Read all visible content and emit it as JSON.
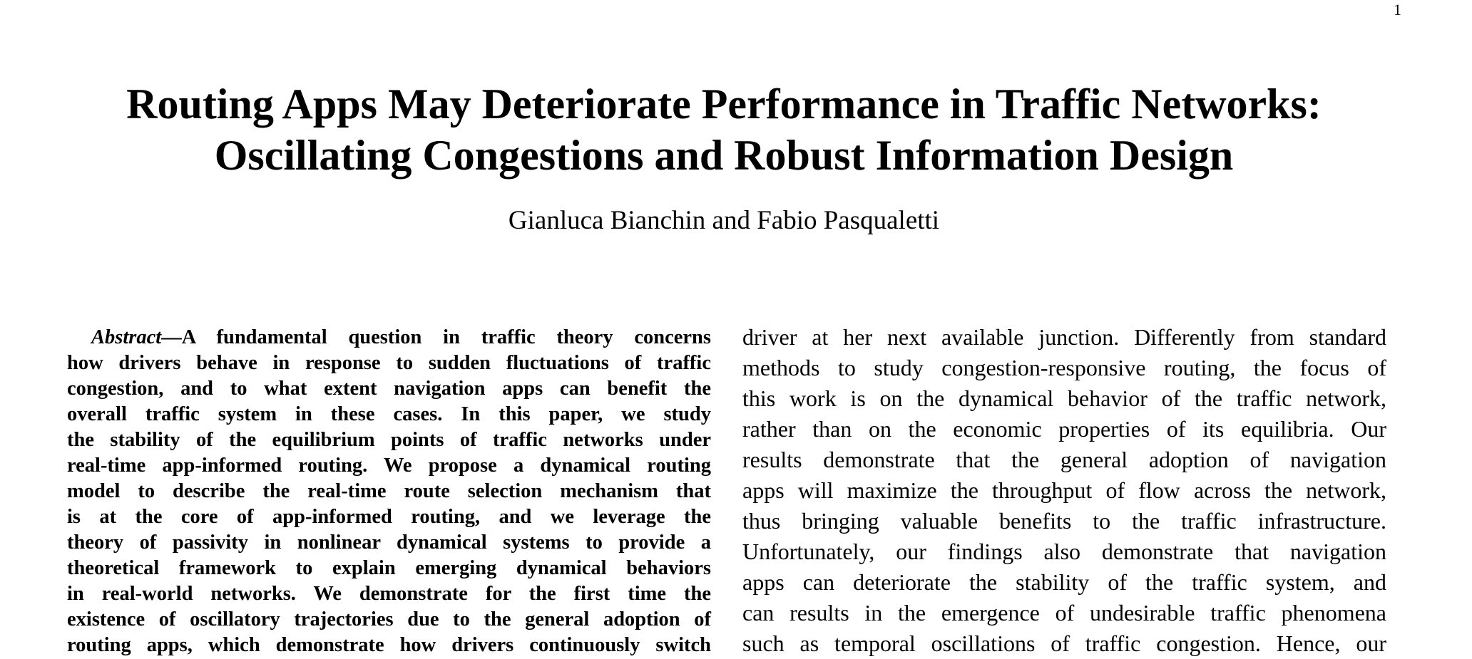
{
  "page": {
    "number": "1"
  },
  "title": {
    "lines": [
      "Routing Apps May Deteriorate Performance in Traffic Networks:",
      "Oscillating Congestions and Robust Information Design"
    ]
  },
  "authors": "Gianluca Bianchin and Fabio Pasqualetti",
  "abstract": {
    "label": "Abstract",
    "dash": "—",
    "first_line": "A fundamental question in traffic theory concerns",
    "lines": [
      "how drivers behave in response to sudden fluctuations of traffic",
      "congestion, and to what extent navigation apps can benefit the",
      "overall traffic system in these cases. In this paper, we study",
      "the stability of the equilibrium points of traffic networks under",
      "real-time app-informed routing. We propose a dynamical routing",
      "model to describe the real-time route selection mechanism that",
      "is at the core of app-informed routing, and we leverage the",
      "theory of passivity in nonlinear dynamical systems to provide a",
      "theoretical framework to explain emerging dynamical behaviors",
      "in real-world networks. We demonstrate for the first time the",
      "existence of oscillatory trajectories due to the general adoption of",
      "routing apps, which demonstrate how drivers continuously switch"
    ]
  },
  "body": {
    "lines": [
      "driver at her next available junction. Differently from standard",
      "methods to study congestion-responsive routing, the focus of",
      "this work is on the dynamical behavior of the traffic network,",
      "rather than on the economic properties of its equilibria. Our",
      "results demonstrate that the general adoption of navigation",
      "apps will maximize the throughput of flow across the network,",
      "thus bringing valuable benefits to the traffic infrastructure.",
      "Unfortunately, our findings also demonstrate that navigation",
      "apps can deteriorate the stability of the traffic system, and",
      "can results in the emergence of undesirable traffic phenomena",
      "such as temporal oscillations of traffic congestion. Hence, our"
    ]
  }
}
